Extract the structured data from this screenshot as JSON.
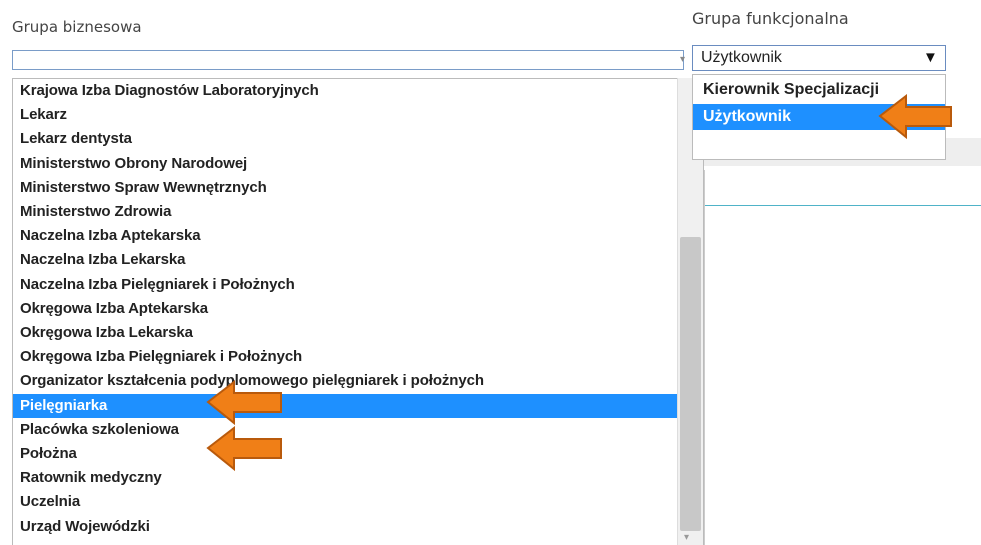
{
  "labels": {
    "business_group": "Grupa biznesowa",
    "functional_group": "Grupa funkcjonalna"
  },
  "business_group": {
    "value": "",
    "options": [
      "Krajowa Izba Diagnostów Laboratoryjnych",
      "Lekarz",
      "Lekarz dentysta",
      "Ministerstwo Obrony Narodowej",
      "Ministerstwo Spraw Wewnętrznych",
      "Ministerstwo Zdrowia",
      "Naczelna Izba Aptekarska",
      "Naczelna Izba Lekarska",
      "Naczelna Izba Pielęgniarek i Położnych",
      "Okręgowa Izba Aptekarska",
      "Okręgowa Izba Lekarska",
      "Okręgowa Izba Pielęgniarek i Położnych",
      "Organizator kształcenia podyplomowego pielęgniarek i położnych",
      "Pielęgniarka",
      "Placówka szkoleniowa",
      "Położna",
      "Ratownik medyczny",
      "Uczelnia",
      "Urząd Wojewódzki"
    ],
    "highlighted": "Pielęgniarka"
  },
  "functional_group": {
    "value": "Użytkownik",
    "options": [
      "Kierownik Specjalizacji",
      "Użytkownik"
    ],
    "highlighted": "Użytkownik"
  },
  "colors": {
    "selection": "#1e90ff",
    "arrow_fill": "#f07f17",
    "arrow_stroke": "#b95a0c"
  },
  "icons": {
    "select_arrow": "▼",
    "scroll_down": "▾"
  }
}
